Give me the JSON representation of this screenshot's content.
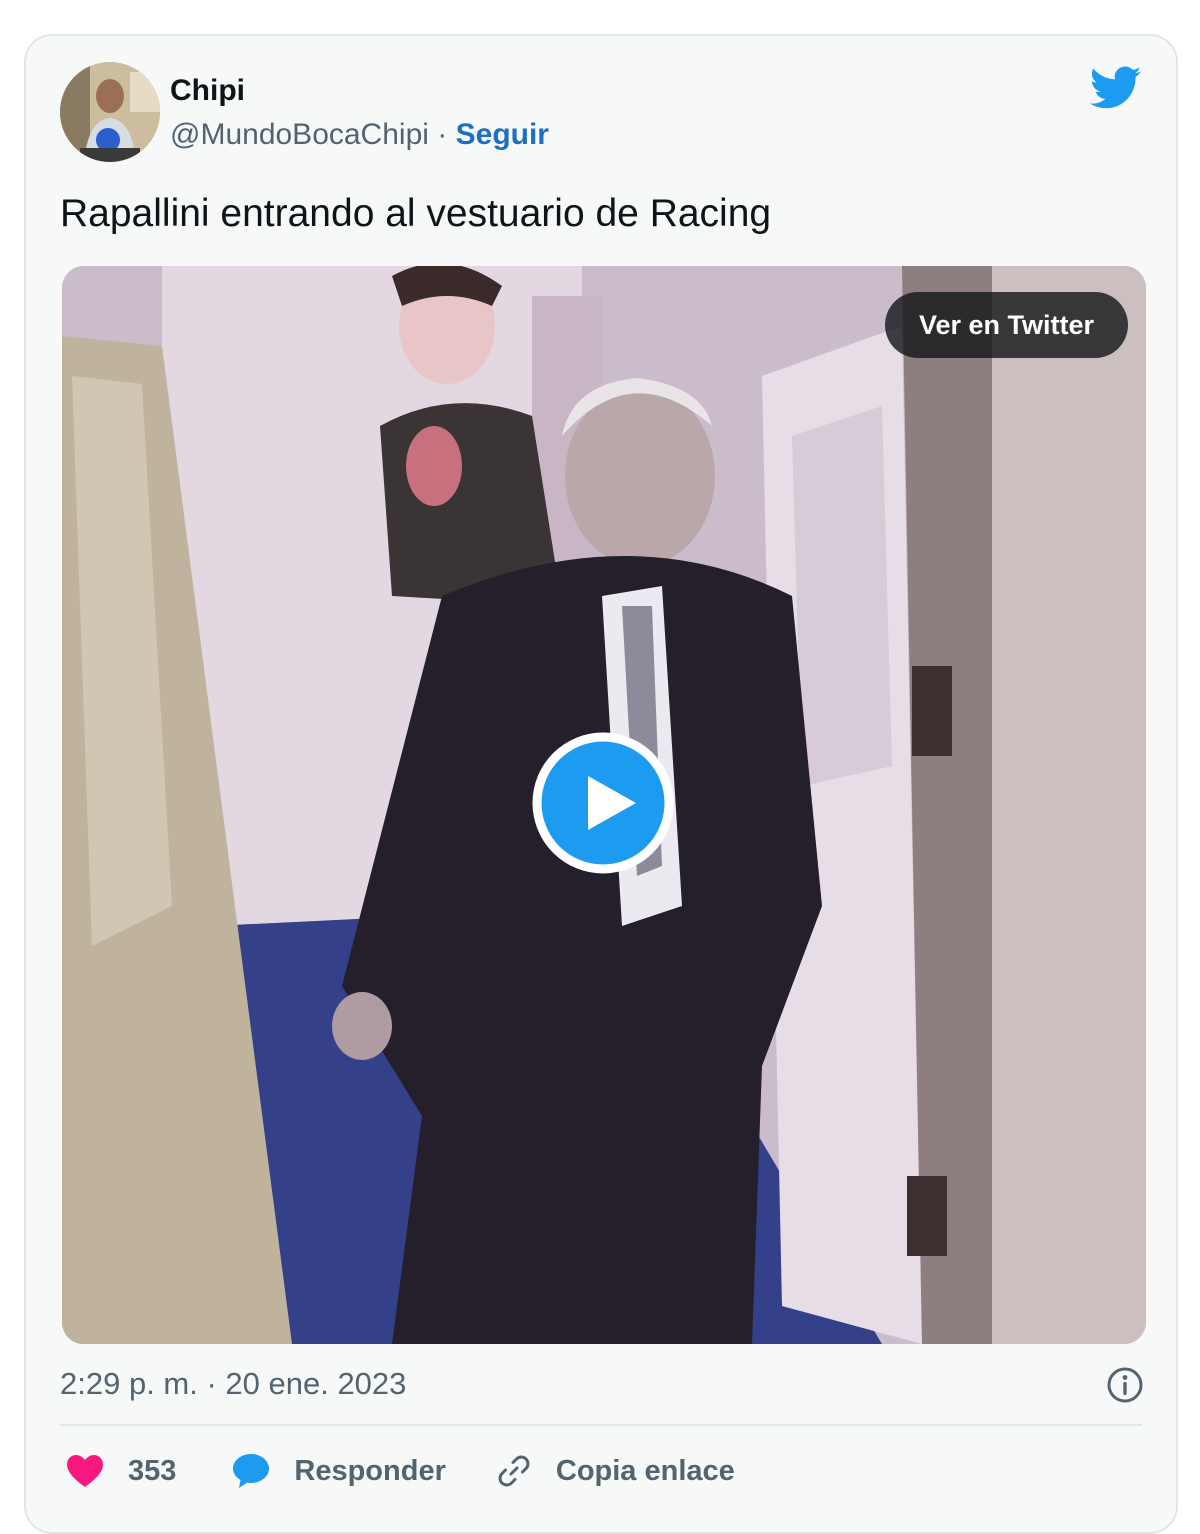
{
  "author": {
    "name": "Chipi",
    "handle": "@MundoBocaChipi",
    "separator": "·",
    "follow_label": "Seguir"
  },
  "tweet": {
    "text": "Rapallini entrando al vestuario de Racing",
    "timestamp": "2:29 p. m. · 20 ene. 2023"
  },
  "media": {
    "view_on_twitter_label": "Ver en Twitter"
  },
  "actions": {
    "likes_count": "353",
    "reply_label": "Responder",
    "copy_link_label": "Copia enlace"
  },
  "colors": {
    "twitter_blue": "#1d9bf0",
    "like_pink": "#f91880",
    "follow_link": "#1d6fc2"
  },
  "icons": [
    "twitter-bird-icon",
    "play-icon",
    "info-icon",
    "heart-icon",
    "reply-bubble-icon",
    "link-icon"
  ]
}
